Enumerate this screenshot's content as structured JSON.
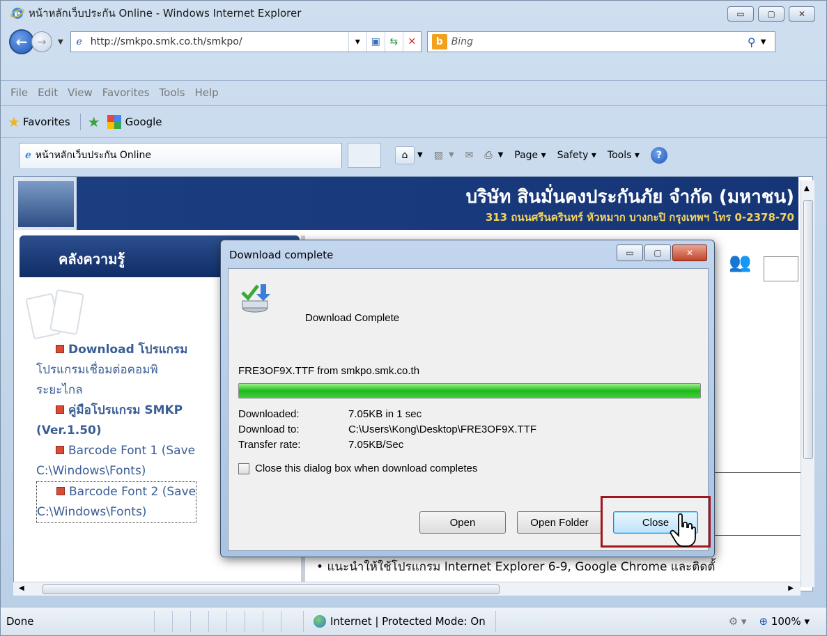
{
  "window": {
    "title": "หน้าหลักเว็บประกัน Online - Windows Internet Explorer",
    "caption_minimize": "▭",
    "caption_maximize": "▢",
    "caption_close": "✕"
  },
  "nav": {
    "url": "http://smkpo.smk.co.th/smkpo/",
    "search_placeholder": "Bing",
    "bing_letter": "b"
  },
  "menu": [
    "File",
    "Edit",
    "View",
    "Favorites",
    "Tools",
    "Help"
  ],
  "favorites": {
    "label": "Favorites",
    "google": "Google"
  },
  "tab": {
    "label": "หน้าหลักเว็บประกัน Online"
  },
  "commandbar": {
    "page": "Page ▾",
    "safety": "Safety ▾",
    "tools": "Tools ▾",
    "help": "?"
  },
  "page": {
    "company_name": "บริษัท สินมั่นคงประกันภัย จำกัด (มหาชน)",
    "company_address": "313 ถนนศรีนครินทร์ หัวหมาก บางกะปิ กรุงเทพฯ โทร 0-2378-70",
    "kb_title": "คลังความรู้",
    "kb_items": [
      "Download โปรแกรม",
      "โปรแกรมเชื่อมต่อคอมพิ",
      "ระยะไกล",
      "คู่มือโปรแกรม SMKP",
      "(Ver.1.50)",
      "Barcode Font 1 (Save",
      "C:\\Windows\\Fonts)",
      "Barcode Font 2 (Save",
      "C:\\Windows\\Fonts)"
    ],
    "bullet_note": "แนะนำให้ใช้โปรแกรม Internet Explorer 6-9, Google Chrome และติดตั้"
  },
  "dialog": {
    "title": "Download complete",
    "heading": "Download Complete",
    "from_line": "FRE3OF9X.TTF from smkpo.smk.co.th",
    "progress_percent": 100,
    "downloaded_label": "Downloaded:",
    "downloaded_value": "7.05KB in 1 sec",
    "download_to_label": "Download to:",
    "download_to_value": "C:\\Users\\Kong\\Desktop\\FRE3OF9X.TTF",
    "rate_label": "Transfer rate:",
    "rate_value": "7.05KB/Sec",
    "checkbox_label": "Close this dialog box when download completes",
    "open_button": "Open",
    "open_folder_button": "Open Folder",
    "close_button": "Close"
  },
  "status": {
    "text": "Done",
    "zone": "Internet | Protected Mode: On",
    "zoom": "100%"
  },
  "colors": {
    "highlight_box": "#a3151a",
    "progress": "#1fb91c",
    "banner": "#163577"
  }
}
